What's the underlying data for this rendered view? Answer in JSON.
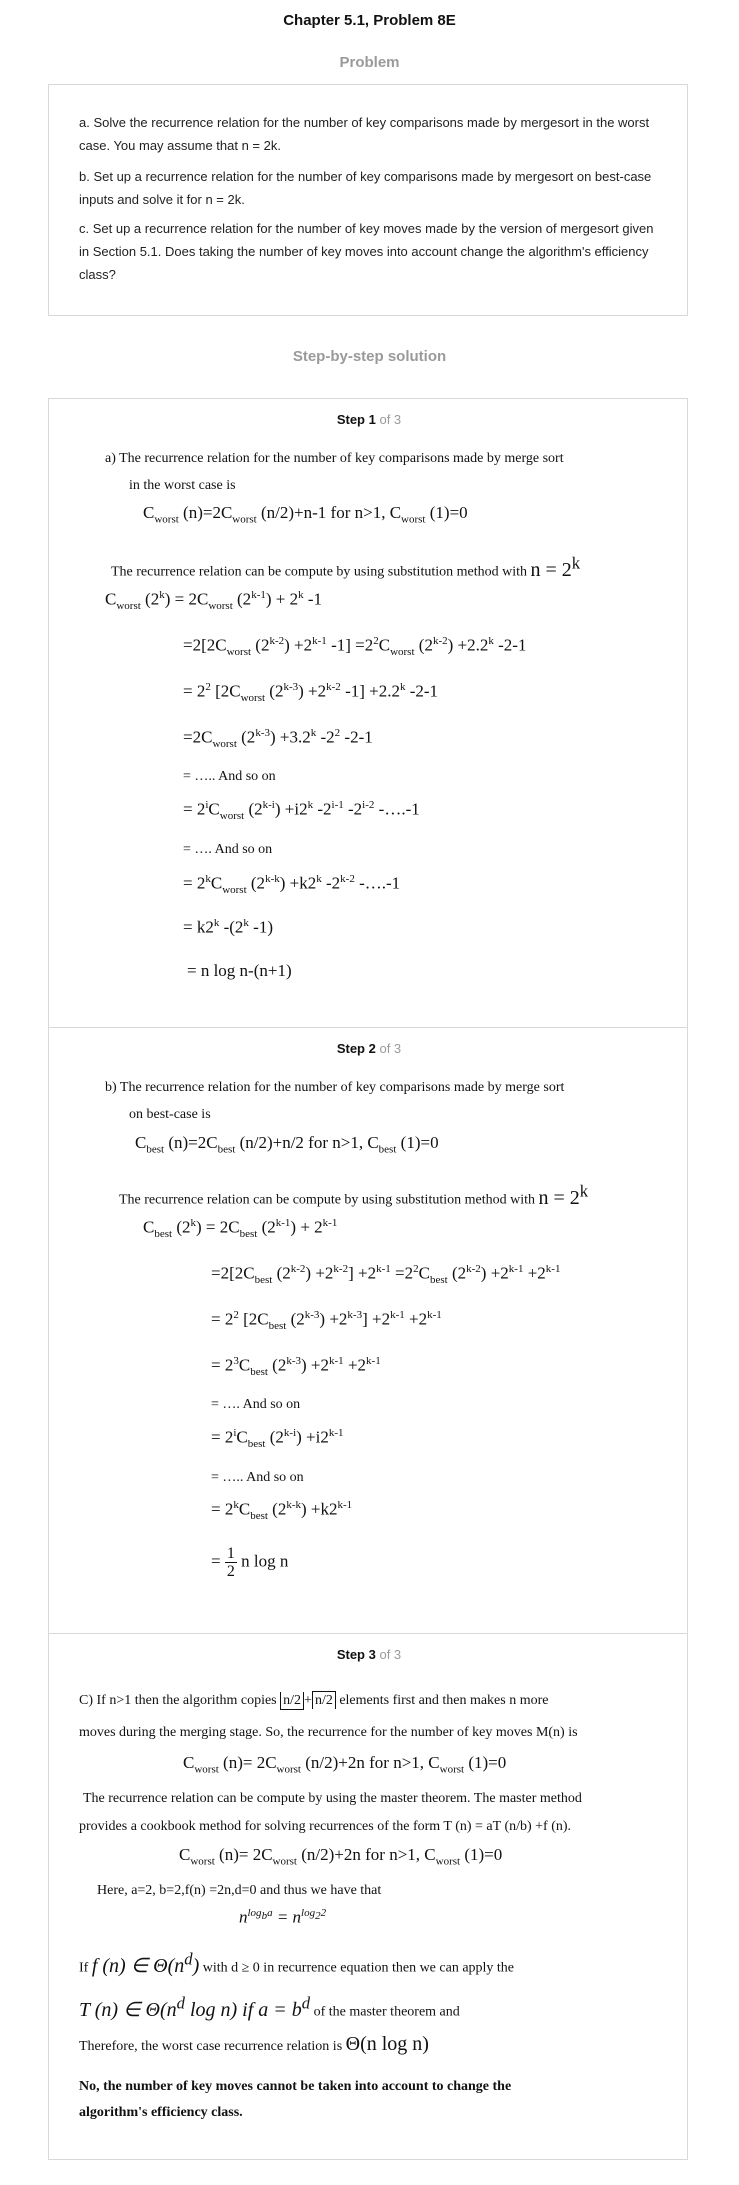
{
  "page": {
    "title": "Chapter 5.1, Problem 8E",
    "problem_heading": "Problem",
    "solution_heading": "Step-by-step solution"
  },
  "problem": {
    "a": "a. Solve the recurrence relation for the number of key comparisons made by mergesort in the worst case. You may assume that n = 2k.",
    "b": "b. Set up a recurrence relation for the number of key comparisons made by mergesort on best-case inputs and solve it for n = 2k.",
    "c": "c. Set up a recurrence relation for the number of key moves made by the version of mergesort given in Section 5.1. Does taking the number of key moves into account change the algorithm's efficiency class?"
  },
  "steps": [
    {
      "label": "Step 1",
      "of": "of 3",
      "intro_1": "a)   The recurrence relation  for the number of key comparisons made by merge sort",
      "intro_2": "in the worst case is",
      "text_sub": "The recurrence relation can be compute by using substitution method with",
      "and_so_on_1": "= ….. And so on",
      "and_so_on_2": "= …. And so on"
    },
    {
      "label": "Step 2",
      "of": "of 3",
      "intro_1": "b)   The recurrence relation for the number of key comparisons made by merge sort",
      "intro_2": "on best-case is",
      "text_sub": "The recurrence relation can be compute by using substitution method with",
      "and_so_on_1": "= …. And so on",
      "and_so_on_2": "= ….. And so on"
    },
    {
      "label": "Step 3",
      "of": "of 3",
      "line_1_a": "C) If n>1 then the algorithm copies",
      "line_1_b": "elements first and then makes n more",
      "line_2": "moves during the merging stage. So, the recurrence for the number of key moves M(n) is",
      "line_3": "The recurrence relation can be compute by using the master theorem. The master method",
      "line_4": "provides a cookbook method for solving recurrences of the form T (n) = aT (n/b) +f (n).",
      "here": "Here, a=2, b=2,f(n) =2n,d=0 and thus we have that",
      "if_a": "If",
      "if_b": "with d ≥ 0  in recurrence equation then we can apply the",
      "master_tail": "of the master theorem and",
      "therefore": "Therefore, the worst case recurrence relation is",
      "conclusion_1": "No, the number of key moves cannot be taken into account to change the",
      "conclusion_2": "algorithm's efficiency class."
    }
  ]
}
